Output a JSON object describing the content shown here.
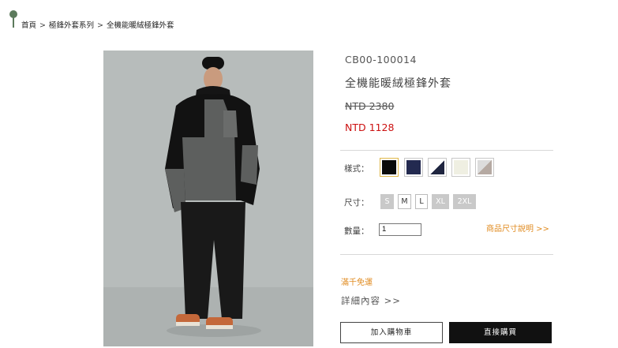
{
  "breadcrumb": {
    "items": [
      "首頁",
      "極鋒外套系列",
      "全機能暖絨極鋒外套"
    ],
    "separator": ">"
  },
  "product": {
    "sku": "CB00-100014",
    "title": "全機能暖絨極鋒外套",
    "original_price": "NTD 2380",
    "sale_price": "NTD 1128",
    "style_label": "樣式：",
    "size_label": "尺寸：",
    "quantity_label": "數量：",
    "quantity_value": "1",
    "size_guide_link": "商品尺寸說明 >>",
    "free_shipping": "滿千免運",
    "details_link": "詳細內容 >>",
    "add_to_cart": "加入購物車",
    "buy_now": "直接購買"
  },
  "styles": [
    {
      "name": "black",
      "colors": [
        "#0a0a0a"
      ],
      "selected": true
    },
    {
      "name": "navy",
      "colors": [
        "#232a50"
      ],
      "selected": false
    },
    {
      "name": "white-navy",
      "colors": [
        "#ffffff",
        "#1f2540"
      ],
      "selected": false
    },
    {
      "name": "cream",
      "colors": [
        "#efefe2"
      ],
      "selected": false
    },
    {
      "name": "taupe-gray",
      "colors": [
        "#b5a9a2",
        "#dcdcdc"
      ],
      "selected": false
    }
  ],
  "sizes": [
    {
      "label": "S",
      "available": false
    },
    {
      "label": "M",
      "available": true
    },
    {
      "label": "L",
      "available": true
    },
    {
      "label": "XL",
      "available": false
    },
    {
      "label": "2XL",
      "available": false
    }
  ],
  "colors": {
    "accent_orange": "#e08a1e",
    "sale_red": "#cc1111",
    "button_dark": "#111111",
    "pin_green": "#5c7a5c"
  }
}
